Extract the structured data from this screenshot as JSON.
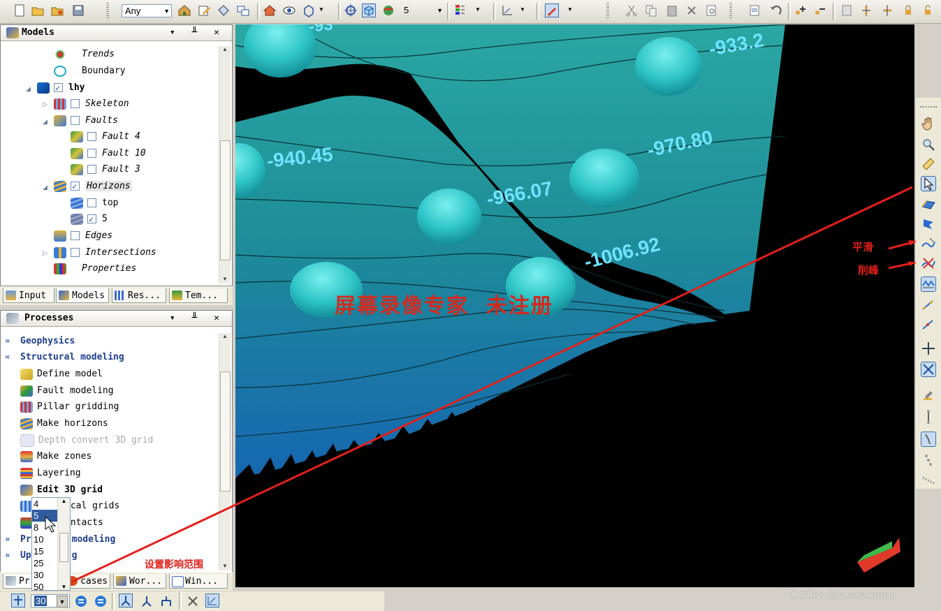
{
  "toolbar": {
    "filter_value": "Any",
    "level_value": "5"
  },
  "models_panel": {
    "title": "Models",
    "controls": "▾ ╨ ✕",
    "tree": [
      {
        "label": "Trends",
        "checkbox": false,
        "checked": false,
        "italic": true
      },
      {
        "label": "Boundary",
        "checkbox": false,
        "checked": false,
        "italic": false
      },
      {
        "label": "lhy",
        "checkbox": true,
        "checked": true,
        "bold": true
      },
      {
        "label": "Skeleton",
        "checkbox": true,
        "checked": false,
        "italic": true
      },
      {
        "label": "Faults",
        "checkbox": true,
        "checked": false,
        "italic": true
      },
      {
        "label": "Fault 4",
        "checkbox": true,
        "checked": false,
        "italic": true
      },
      {
        "label": "Fault 10",
        "checkbox": true,
        "checked": false,
        "italic": true
      },
      {
        "label": "Fault 3",
        "checkbox": true,
        "checked": false,
        "italic": true
      },
      {
        "label": "Horizons",
        "checkbox": true,
        "checked": true,
        "italic": true,
        "selected": true
      },
      {
        "label": "top",
        "checkbox": true,
        "checked": false
      },
      {
        "label": "5",
        "checkbox": true,
        "checked": true
      },
      {
        "label": "Edges",
        "checkbox": true,
        "checked": false,
        "italic": true
      },
      {
        "label": "Intersections",
        "checkbox": true,
        "checked": false,
        "italic": true
      },
      {
        "label": "Properties",
        "checkbox": false,
        "checked": false,
        "italic": true
      }
    ],
    "tabs": [
      "Input",
      "Models",
      "Res...",
      "Tem..."
    ]
  },
  "processes_panel": {
    "title": "Processes",
    "controls": "▾ ╨ ✕",
    "items": [
      {
        "label": "Geophysics",
        "type": "group",
        "chevron": "»"
      },
      {
        "label": "Structural modeling",
        "type": "group",
        "chevron": "«"
      },
      {
        "label": "Define model",
        "type": "item"
      },
      {
        "label": "Fault modeling",
        "type": "item"
      },
      {
        "label": "Pillar gridding",
        "type": "item"
      },
      {
        "label": "Make horizons",
        "type": "item"
      },
      {
        "label": "Depth convert 3D grid",
        "type": "disabled"
      },
      {
        "label": "Make zones",
        "type": "item"
      },
      {
        "label": "Layering",
        "type": "item"
      },
      {
        "label": "Edit 3D grid",
        "type": "bold"
      },
      {
        "label": "ocal grids",
        "type": "item"
      },
      {
        "label": "ontacts",
        "type": "item"
      },
      {
        "label": "Pr",
        "suffix": "modeling",
        "type": "group",
        "chevron": "»"
      },
      {
        "label": "Up",
        "suffix": "g",
        "type": "group",
        "chevron": "»"
      }
    ],
    "tabs": [
      "Pr",
      "cases",
      "Wor...",
      "Win..."
    ]
  },
  "radius_dropdown": {
    "options": [
      "4",
      "5",
      "8",
      "10",
      "15",
      "25",
      "30",
      "50"
    ],
    "selected": "5",
    "current_value": "30"
  },
  "viewport": {
    "contour_labels": [
      "-940.45",
      "-966.07",
      "-970.80",
      "-1006.92",
      "-933.2",
      "-93"
    ],
    "watermark": "屏幕录像专家  未注册"
  },
  "annotations": {
    "smooth": "平滑",
    "peak_cut": "削峰",
    "set_range": "设置影响范围"
  },
  "footer_watermark": "CSDN @xiaokcehui"
}
